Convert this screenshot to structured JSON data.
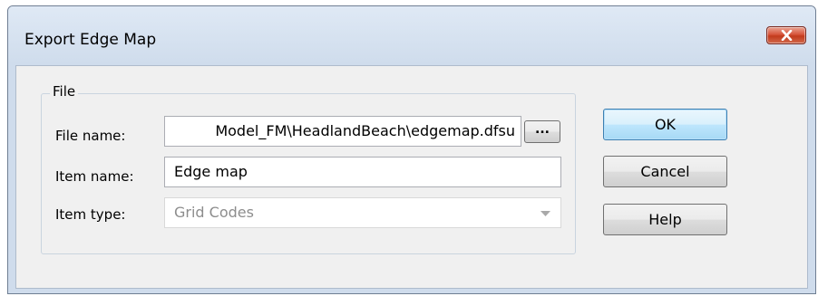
{
  "window": {
    "title": "Export Edge Map"
  },
  "group": {
    "legend": "File"
  },
  "fields": {
    "file_name_label": "File name:",
    "file_name_value": "Model_FM\\HeadlandBeach\\edgemap.dfsu",
    "item_name_label": "Item name:",
    "item_name_value": "Edge map",
    "item_type_label": "Item type:",
    "item_type_value": "Grid Codes"
  },
  "browse": {
    "label": "..."
  },
  "buttons": {
    "ok": "OK",
    "cancel": "Cancel",
    "help": "Help"
  },
  "icons": {
    "close": "close-icon",
    "dropdown": "chevron-down-icon"
  },
  "colors": {
    "title_bar": "#cfdcec",
    "close_button": "#c8432a",
    "dialog_body": "#f0f0f0"
  }
}
